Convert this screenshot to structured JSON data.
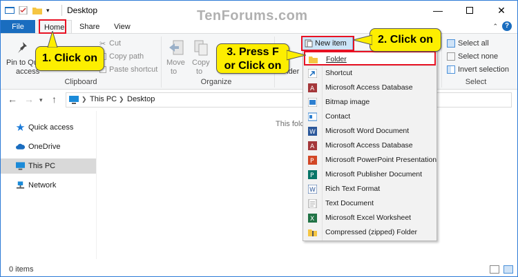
{
  "title_bar": {
    "title": "Desktop",
    "watermark": "TenForums.com",
    "minimize_icon": "minimize-icon",
    "maximize_icon": "maximize-icon",
    "close_icon": "close-icon"
  },
  "ribbon": {
    "tabs": [
      {
        "label": "File"
      },
      {
        "label": "Home"
      },
      {
        "label": "Share"
      },
      {
        "label": "View"
      }
    ],
    "clipboard": {
      "pin_label": "Pin to Quick access",
      "pin_line1": "Pin to Qu",
      "pin_line2": "access",
      "cut": "Cut",
      "copy_path": "Copy path",
      "paste_shortcut": "Paste shortcut",
      "group": "Clipboard"
    },
    "organize": {
      "move_to": "Move to",
      "move_line1": "Move",
      "move_line2": "to",
      "copy_to": "Copy to",
      "copy_line1": "Copy",
      "copy_line2": "to",
      "group": "Organize"
    },
    "new": {
      "new_item": "New item",
      "new_folder_fragment": "lder",
      "new_fragment": "w"
    },
    "select": {
      "select_all": "Select all",
      "select_none": "Select none",
      "invert": "Invert selection",
      "group": "Select"
    }
  },
  "address_bar": {
    "path": [
      "This PC",
      "Desktop"
    ],
    "search_placeholder_fragment": "op"
  },
  "nav_pane": {
    "items": [
      {
        "label": "Quick access",
        "icon": "star-icon"
      },
      {
        "label": "OneDrive",
        "icon": "cloud-icon"
      },
      {
        "label": "This PC",
        "icon": "computer-icon",
        "selected": true
      },
      {
        "label": "Network",
        "icon": "network-icon"
      }
    ]
  },
  "content": {
    "empty_message": "This fold"
  },
  "status_bar": {
    "items_count": "0 items"
  },
  "new_item_menu": {
    "items": [
      {
        "label": "Folder",
        "icon": "folder-icon",
        "highlighted": true
      },
      {
        "label": "Shortcut",
        "icon": "shortcut-icon"
      },
      {
        "label": "Microsoft Access Database",
        "icon": "access-icon"
      },
      {
        "label": "Bitmap image",
        "icon": "bitmap-icon"
      },
      {
        "label": "Contact",
        "icon": "contact-icon"
      },
      {
        "label": "Microsoft Word Document",
        "icon": "word-icon"
      },
      {
        "label": "Microsoft Access Database",
        "icon": "access-icon"
      },
      {
        "label": "Microsoft PowerPoint Presentation",
        "icon": "powerpoint-icon"
      },
      {
        "label": "Microsoft Publisher Document",
        "icon": "publisher-icon"
      },
      {
        "label": "Rich Text Format",
        "icon": "rtf-icon"
      },
      {
        "label": "Text Document",
        "icon": "text-icon"
      },
      {
        "label": "Microsoft Excel Worksheet",
        "icon": "excel-icon"
      },
      {
        "label": "Compressed (zipped) Folder",
        "icon": "zip-icon"
      }
    ]
  },
  "callouts": {
    "step1": "1. Click on",
    "step2": "2. Click on",
    "step3_line1": "3. Press F",
    "step3_line2": "or Click on"
  },
  "colors": {
    "accent": "#1a6dbf",
    "callout": "#fdee00",
    "highlight_border": "#e81123"
  }
}
